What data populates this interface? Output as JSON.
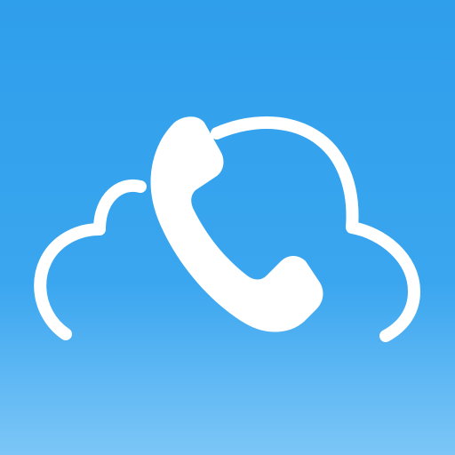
{
  "app_icon": {
    "icons": {
      "cloud": "cloud-icon",
      "phone": "phone-handset-icon"
    },
    "colors": {
      "background_top": "#2f9eeb",
      "background_bottom": "#7cc6f7",
      "glyph": "#ffffff"
    }
  }
}
